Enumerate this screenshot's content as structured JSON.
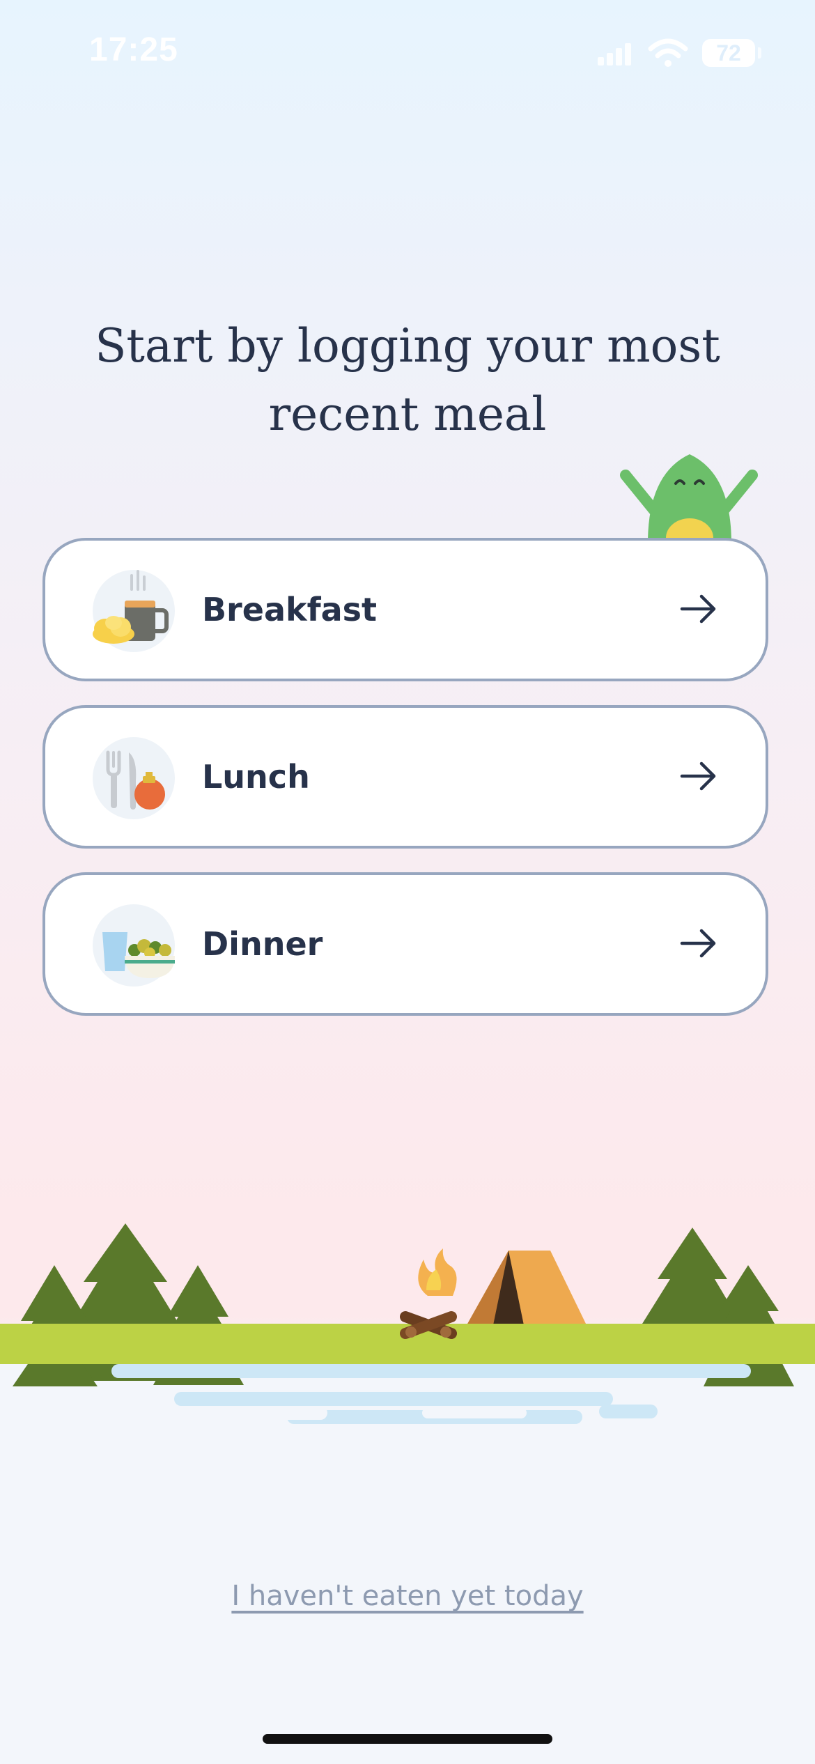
{
  "status_bar": {
    "time": "17:25",
    "battery": "72"
  },
  "headline": "Start by logging your most recent meal",
  "meals": [
    {
      "label": "Breakfast",
      "icon": "breakfast-icon"
    },
    {
      "label": "Lunch",
      "icon": "lunch-icon"
    },
    {
      "label": "Dinner",
      "icon": "dinner-icon"
    }
  ],
  "skip_link": "I haven't eaten yet today",
  "colors": {
    "text_dark": "#27324a",
    "card_border": "#97a6bf",
    "grass": "#bcd245",
    "tree": "#5a792b",
    "tent": "#eea94f",
    "mascot": "#6cbf6a"
  }
}
